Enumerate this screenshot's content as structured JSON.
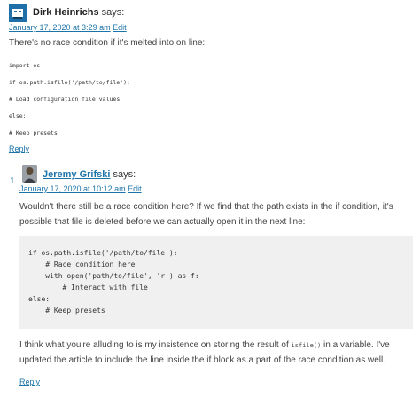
{
  "comment1": {
    "avatar_icon": "avatar-icon",
    "author": "Dirk Heinrichs",
    "says": "says:",
    "date": "January 17, 2020 at 3:29 am",
    "edit": "Edit",
    "text": "There's no race condition if it's melted into on line:",
    "code": [
      "import os",
      "if os.path.isfile('/path/to/file'):",
      "# Load configuration file values",
      "else:",
      "# Keep presets"
    ],
    "reply": "Reply"
  },
  "comment2": {
    "number": "1.",
    "author": "Jeremy Grifski",
    "says": "says:",
    "date": "January 17, 2020 at 10:12 am",
    "edit": "Edit",
    "text_line1": "Wouldn't there still be a race condition here? If we find that the path exists in the if condition, it's",
    "text_line2": "possible that file is deleted before we can actually open it in the next line:",
    "code": [
      "if os.path.isfile('/path/to/file'):",
      "    # Race condition here",
      "    with open('path/to/file', 'r') as f:",
      "        # Interact with file",
      "else:",
      "    # Keep presets"
    ],
    "text2_line1_a": "I think what you're alluding to is my insistence on storing the result of ",
    "text2_inline_code": "isfile()",
    "text2_line1_b": " in a variable. I've",
    "text2_line2": "updated the article to include the line inside the if block as a part of the race condition as well.",
    "reply": "Reply"
  }
}
